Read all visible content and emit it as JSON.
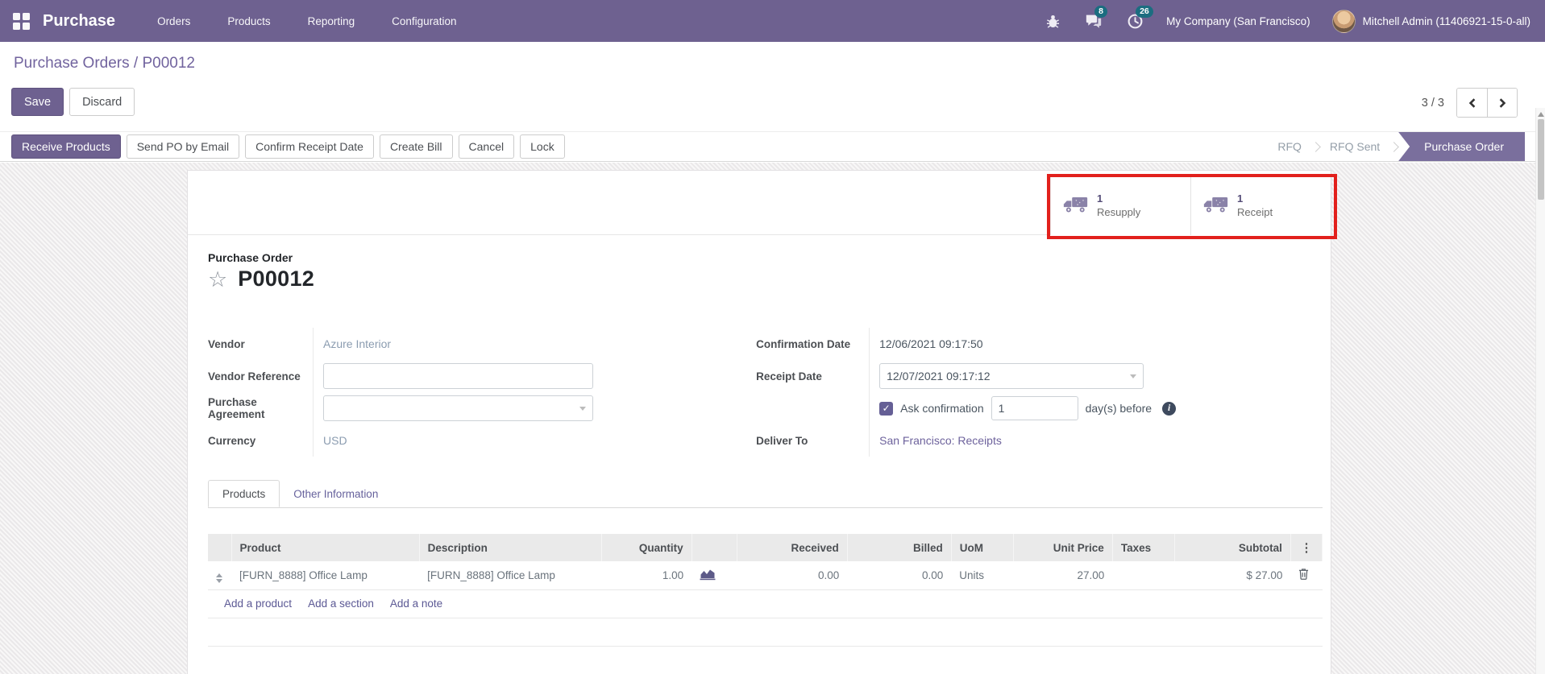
{
  "navbar": {
    "brand": "Purchase",
    "menus": [
      {
        "label": "Orders"
      },
      {
        "label": "Products"
      },
      {
        "label": "Reporting"
      },
      {
        "label": "Configuration"
      }
    ],
    "messages_badge": "8",
    "activities_badge": "26",
    "company": "My Company (San Francisco)",
    "user": "Mitchell Admin (11406921-15-0-all)"
  },
  "control_panel": {
    "breadcrumb": {
      "parent": "Purchase Orders",
      "separator": " / ",
      "current": "P00012"
    },
    "save": "Save",
    "discard": "Discard",
    "pager": "3 / 3"
  },
  "statusbar": {
    "buttons": [
      "Receive Products",
      "Send PO by Email",
      "Confirm Receipt Date",
      "Create Bill",
      "Cancel",
      "Lock"
    ],
    "states": [
      "RFQ",
      "RFQ Sent",
      "Purchase Order"
    ],
    "active_state": "Purchase Order"
  },
  "smart_buttons": [
    {
      "count": "1",
      "label": "Resupply"
    },
    {
      "count": "1",
      "label": "Receipt"
    }
  ],
  "sheet": {
    "title_label": "Purchase Order",
    "title": "P00012"
  },
  "fields": {
    "vendor": {
      "label": "Vendor",
      "value": "Azure Interior"
    },
    "vendor_reference": {
      "label": "Vendor Reference",
      "value": ""
    },
    "purchase_agreement": {
      "label": "Purchase Agreement",
      "value": ""
    },
    "currency": {
      "label": "Currency",
      "value": "USD"
    },
    "confirmation_date": {
      "label": "Confirmation Date",
      "value": "12/06/2021 09:17:50"
    },
    "receipt_date": {
      "label": "Receipt Date",
      "value": "12/07/2021 09:17:12"
    },
    "ask_confirmation": {
      "label": "Ask confirmation",
      "checked": true,
      "days": "1",
      "suffix": "day(s) before"
    },
    "deliver_to": {
      "label": "Deliver To",
      "value": "San Francisco: Receipts"
    }
  },
  "tabs": [
    {
      "label": "Products",
      "active": true
    },
    {
      "label": "Other Information",
      "active": false
    }
  ],
  "lines_table": {
    "headers": {
      "product": "Product",
      "description": "Description",
      "quantity": "Quantity",
      "received": "Received",
      "billed": "Billed",
      "uom": "UoM",
      "unit_price": "Unit Price",
      "taxes": "Taxes",
      "subtotal": "Subtotal"
    },
    "rows": [
      {
        "product": "[FURN_8888] Office Lamp",
        "description": "[FURN_8888] Office Lamp",
        "quantity": "1.00",
        "received": "0.00",
        "billed": "0.00",
        "uom": "Units",
        "unit_price": "27.00",
        "taxes": "",
        "subtotal": "$ 27.00"
      }
    ],
    "links": [
      "Add a product",
      "Add a section",
      "Add a note"
    ]
  },
  "icons": [
    "apps-grid-icon",
    "bug-icon",
    "chat-icon",
    "clock-icon",
    "truck-icon",
    "star-icon",
    "drag-handle-icon",
    "forecast-chart-icon",
    "trash-icon",
    "chevron-left-icon",
    "chevron-right-icon",
    "dropdown-caret-icon",
    "check-icon",
    "info-icon",
    "kebab-menu-icon"
  ],
  "colors": {
    "brand_purple": "#6e6190",
    "ribbon_purple": "#7a6f9d",
    "badge_teal": "#1b6d80",
    "annotation_red": "#e2201c",
    "link_purple": "#6d629c",
    "link_muted_blue": "#8b9cb0"
  }
}
